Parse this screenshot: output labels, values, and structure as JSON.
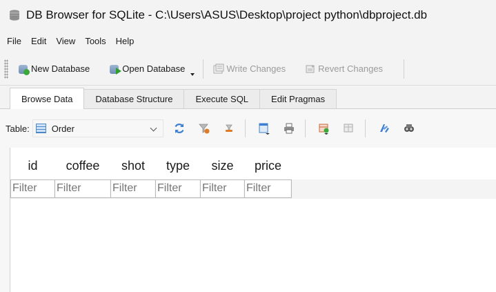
{
  "window": {
    "title": "DB Browser for SQLite - C:\\Users\\ASUS\\Desktop\\project python\\dbproject.db"
  },
  "menu": [
    "File",
    "Edit",
    "View",
    "Tools",
    "Help"
  ],
  "toolbar": {
    "new_database": "New Database",
    "open_database": "Open Database",
    "write_changes": "Write Changes",
    "revert_changes": "Revert Changes"
  },
  "tabs": [
    "Browse Data",
    "Database Structure",
    "Execute SQL",
    "Edit Pragmas"
  ],
  "browse": {
    "table_label": "Table:",
    "selected_table": "Order",
    "columns": [
      "id",
      "coffee",
      "shot",
      "type",
      "size",
      "price"
    ],
    "filter_placeholder": "Filter"
  },
  "colors": {
    "accent_blue": "#3c7fd0",
    "add_green": "#3aa83a",
    "orange": "#e07b25",
    "disabled_text": "#9b9b9b"
  },
  "icons": {
    "app": "db-browser-icon",
    "refresh": "refresh-icon",
    "clear_filters": "clear-filter-icon",
    "save_filter": "save-filter-icon",
    "print": "print-icon",
    "find": "find-icon"
  }
}
